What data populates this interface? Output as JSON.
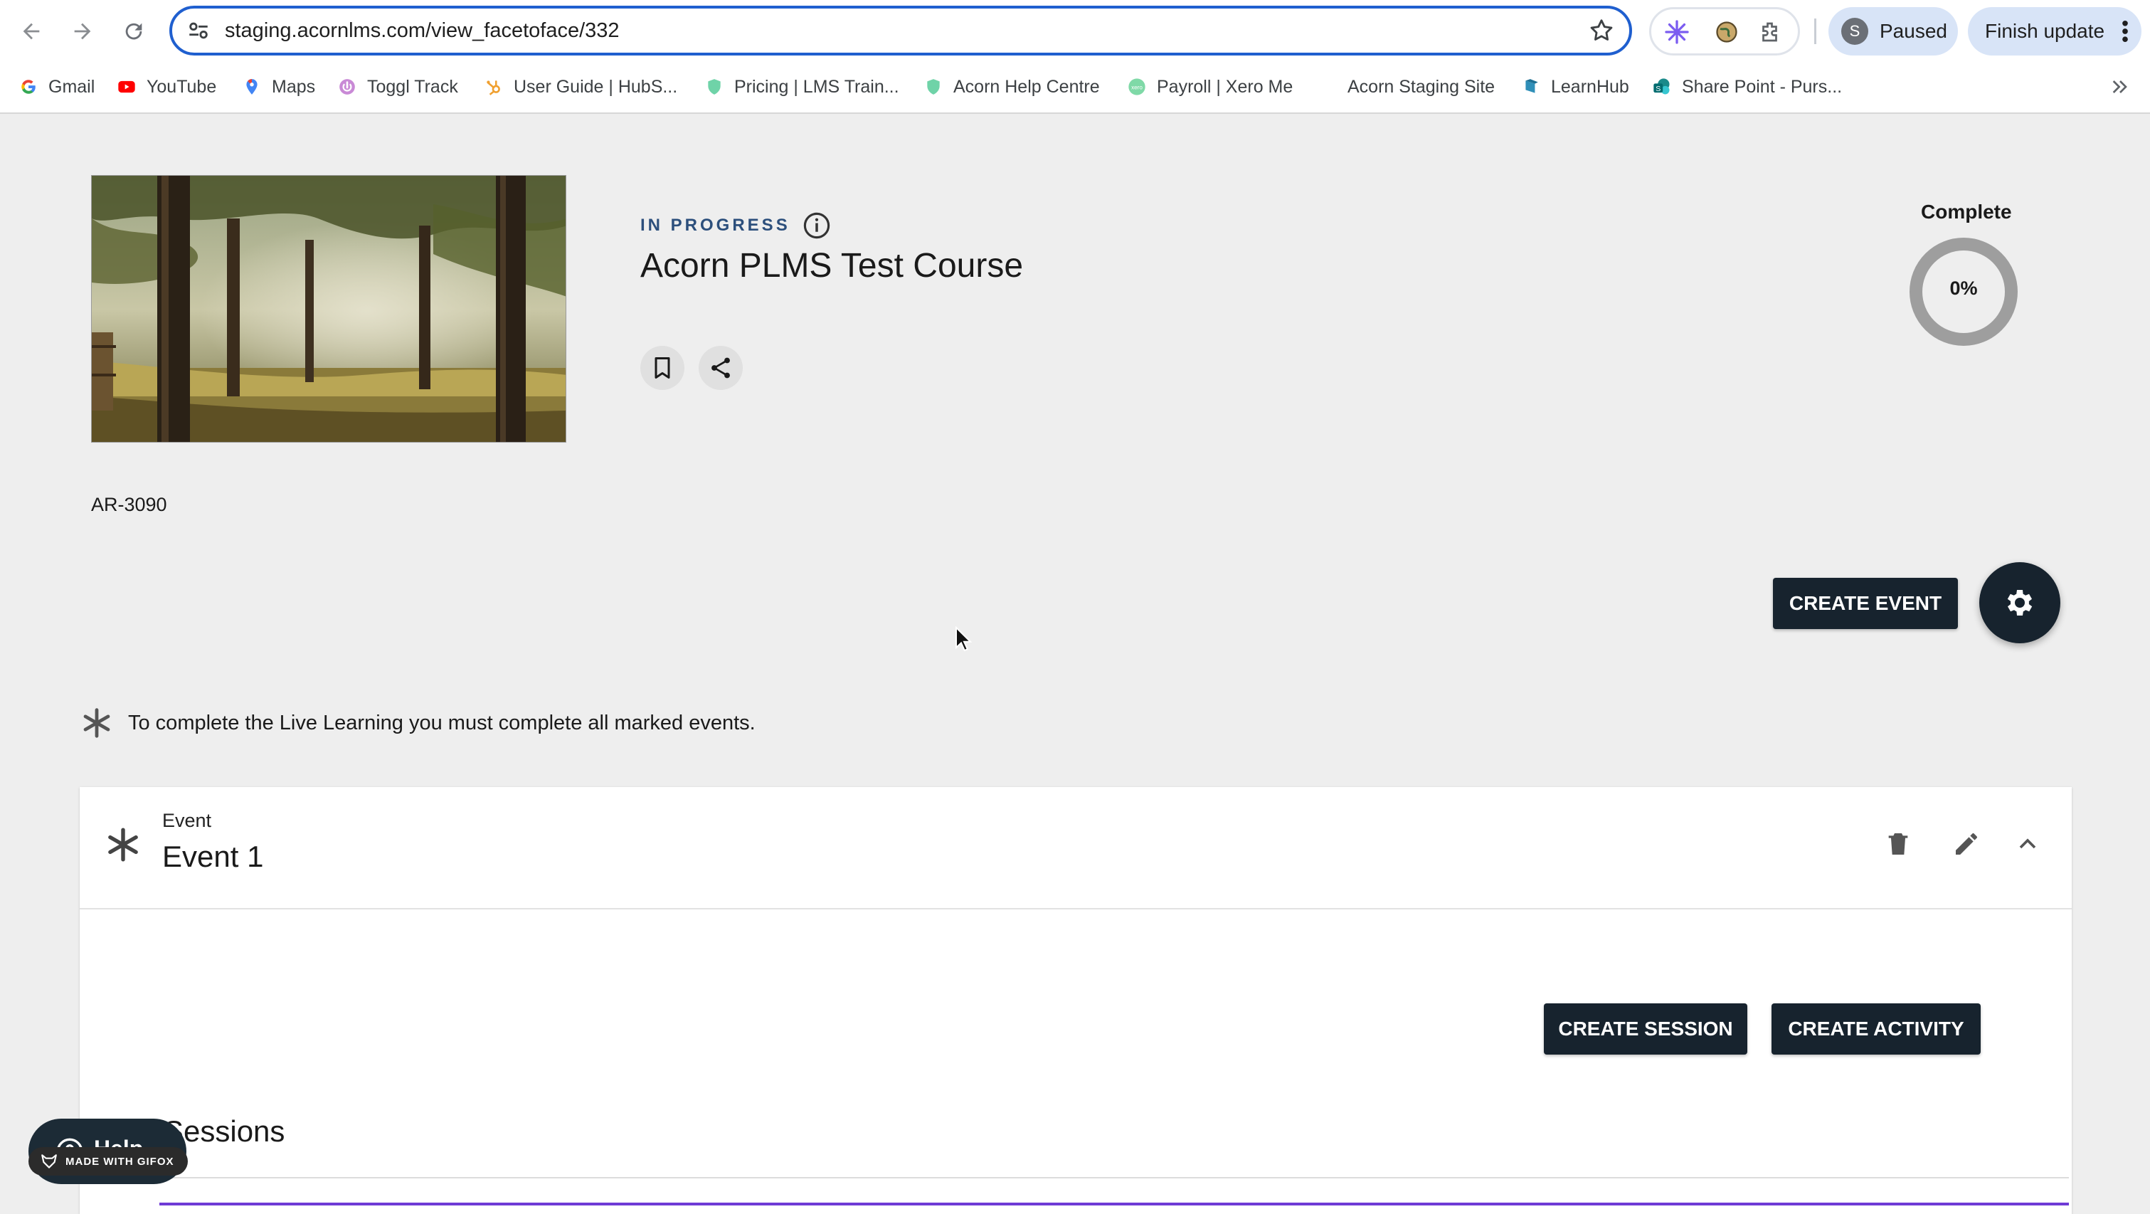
{
  "browser": {
    "url": "staging.acornlms.com/view_facetoface/332",
    "profile_initial": "S",
    "profile_status": "Paused",
    "update_label": "Finish update",
    "bookmarks": [
      {
        "label": "Gmail",
        "icon": "google-icon"
      },
      {
        "label": "YouTube",
        "icon": "youtube-icon"
      },
      {
        "label": "Maps",
        "icon": "maps-pin-icon"
      },
      {
        "label": "Toggl Track",
        "icon": "toggl-icon"
      },
      {
        "label": "User Guide | HubS...",
        "icon": "hubspot-icon"
      },
      {
        "label": "Pricing | LMS Train...",
        "icon": "acorn-shield-icon"
      },
      {
        "label": "Acorn Help Centre",
        "icon": "acorn-shield-icon"
      },
      {
        "label": "Payroll | Xero Me",
        "icon": "xero-icon"
      },
      {
        "label": "Acorn Staging Site",
        "icon": ""
      },
      {
        "label": "LearnHub",
        "icon": "learnhub-icon"
      },
      {
        "label": "Share Point - Purs...",
        "icon": "sharepoint-icon"
      }
    ]
  },
  "course": {
    "status": "IN PROGRESS",
    "title": "Acorn PLMS Test Course",
    "code": "AR-3090",
    "complete_label": "Complete",
    "complete_percent": "0%",
    "progress_fraction": 0
  },
  "actions": {
    "create_event": "CREATE EVENT",
    "create_session": "CREATE SESSION",
    "create_activity": "CREATE ACTIVITY"
  },
  "note": "To complete the Live Learning you must complete all marked events.",
  "event": {
    "label": "Event",
    "name": "Event 1",
    "sessions_title": "Sessions"
  },
  "overlay": {
    "help_label": "Help",
    "gifox_label": "MADE WITH GIFOX"
  },
  "colors": {
    "accent_dark": "#17232e",
    "status_blue": "#2c4f7c",
    "purple": "#6f3bd6"
  }
}
